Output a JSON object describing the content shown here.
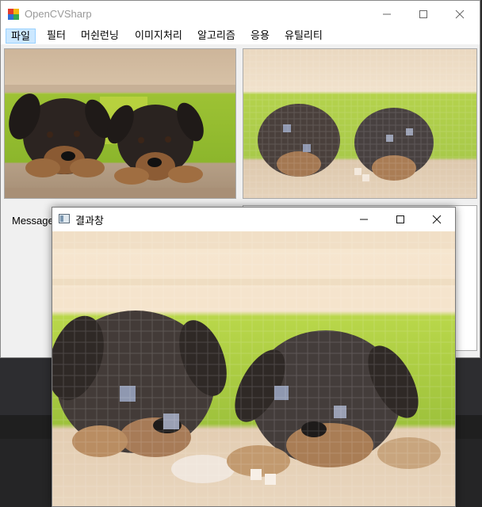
{
  "main_window": {
    "title": "OpenCVSharp",
    "menu": [
      {
        "label": "파일"
      },
      {
        "label": "필터"
      },
      {
        "label": "머쉰런닝"
      },
      {
        "label": "이미지처리"
      },
      {
        "label": "알고리즘"
      },
      {
        "label": "응용"
      },
      {
        "label": "유틸리티"
      }
    ],
    "message_label": "Message"
  },
  "result_window": {
    "title": "결과창"
  },
  "icons": {
    "app": "opencv-app-icon",
    "window": "window-icon",
    "minimize": "minimize-icon",
    "maximize": "maximize-icon",
    "close": "close-icon"
  },
  "images": {
    "original": "two rottweiler puppies over a wooden fence",
    "result": "mosaic-filtered puppies image",
    "popup": "enlarged mosaic-filtered puppies image"
  }
}
